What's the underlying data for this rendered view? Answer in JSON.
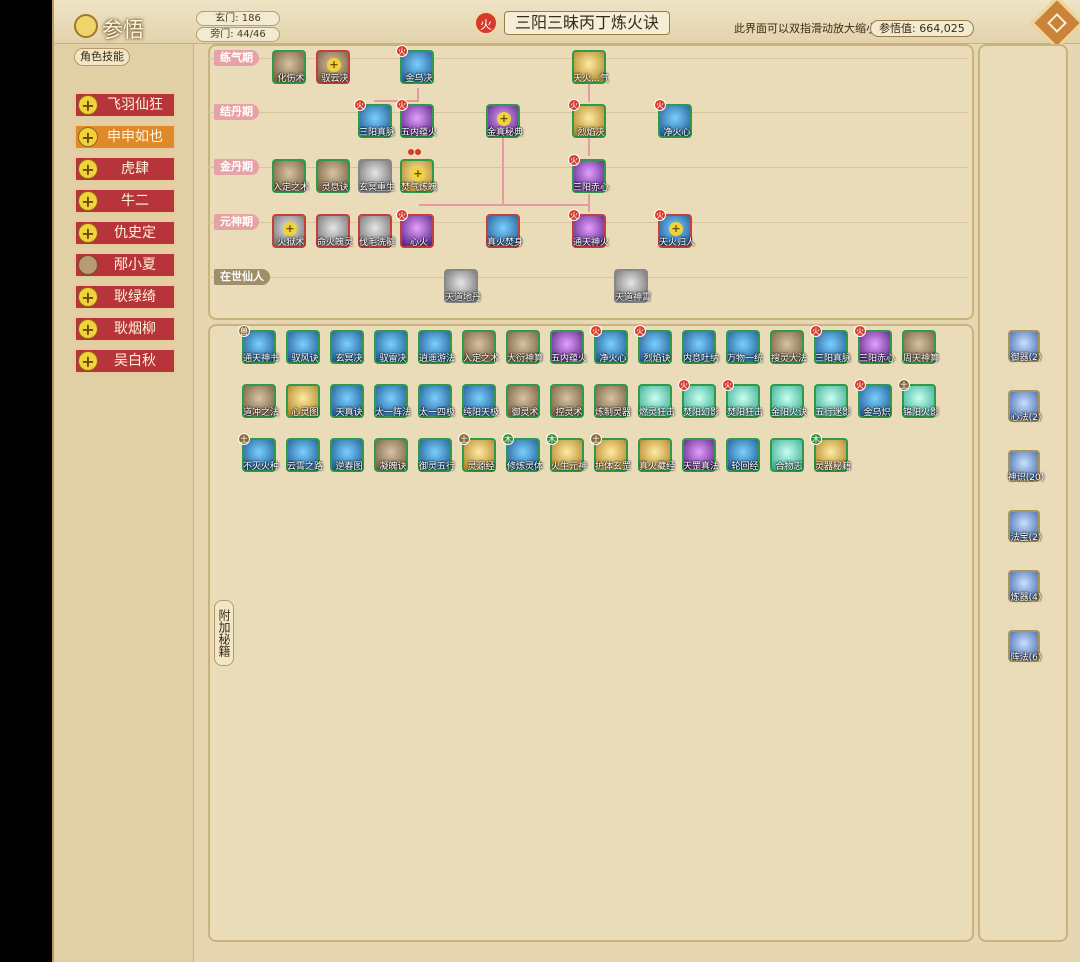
{
  "header": {
    "title": "参悟",
    "xuanmen": "玄门: 186",
    "pangmen": "旁门: 44/46",
    "element_badge": "火",
    "method_name": "三阳三昧丙丁炼火诀",
    "hint": "此界面可以双指滑动放大缩小",
    "score": "参悟值: 664,025"
  },
  "characters": [
    {
      "name": "飞羽仙狂",
      "active": false
    },
    {
      "name": "申申如也",
      "active": true
    },
    {
      "name": "虎肆",
      "active": false
    },
    {
      "name": "牛二",
      "active": false
    },
    {
      "name": "仇史定",
      "active": false
    },
    {
      "name": "邴小夏",
      "active": false
    },
    {
      "name": "耿绿绮",
      "active": false
    },
    {
      "name": "耿烟柳",
      "active": false
    },
    {
      "name": "吴白秋",
      "active": false
    }
  ],
  "stages": [
    "练气期",
    "结丹期",
    "金丹期",
    "元神期",
    "在世仙人"
  ],
  "tree_nodes": [
    {
      "label": "化伤术"
    },
    {
      "label": "驭云决"
    },
    {
      "label": "金乌决"
    },
    {
      "label": "天火...气"
    },
    {
      "label": "三阳真脉"
    },
    {
      "label": "五内蕴火"
    },
    {
      "label": "金真秘典"
    },
    {
      "label": "烈焰决"
    },
    {
      "label": "净火心"
    },
    {
      "label": "入定之术"
    },
    {
      "label": "灵息诀"
    },
    {
      "label": "玄冥重生"
    },
    {
      "label": "焚气炼魄"
    },
    {
      "label": "三阳赤心"
    },
    {
      "label": "火狱术"
    },
    {
      "label": "命火魄灵"
    },
    {
      "label": "伐毛洗髓"
    },
    {
      "label": "心火"
    },
    {
      "label": "真火焚身"
    },
    {
      "label": "通天神火"
    },
    {
      "label": "天火归人"
    },
    {
      "label": "天道地丹"
    },
    {
      "label": "天道神霄"
    }
  ],
  "skills": [
    "通天神书",
    "驭风诀",
    "玄冥决",
    "驭雷决",
    "逍遥游法",
    "入定之术",
    "大衍神算",
    "五内蕴火",
    "净火心",
    "烈焰诀",
    "内息吐纳",
    "万物一统",
    "搜灵大法",
    "三阳真脉",
    "三阳赤心",
    "周天神算",
    "道冲之法",
    "心灵图",
    "天真诀",
    "太一阵法",
    "太一四极",
    "纯阳天极",
    "御灵术",
    "控灵术",
    "炼制灵器",
    "燃灵狂击",
    "焚阳幻影",
    "焚阳狂击",
    "金阳火诀",
    "五行迷影",
    "金乌炽",
    "锦阳火影",
    "不灭火种",
    "云霄之路",
    "逆春图",
    "凝魄诀",
    "御灵五行",
    "灵源经",
    "修炼灵体",
    "火生元神",
    "护体玄罡",
    "真火藏经",
    "天罡真法",
    "轮回经",
    "合物志",
    "灵器秘籍"
  ],
  "side_tab": "附加秘籍",
  "role_panel": {
    "title": "角色技能",
    "skills": [
      "御器(2)",
      "心法(2)",
      "神识(20)",
      "法宝(2)",
      "炼器(4)",
      "阵法(6)"
    ]
  }
}
